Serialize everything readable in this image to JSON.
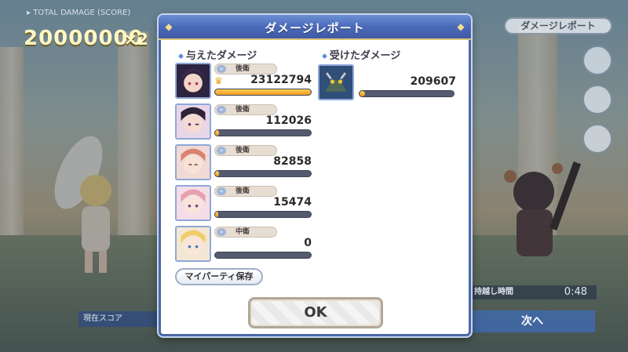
{
  "background": {
    "score_label": "▸ TOTAL DAMAGE (SCORE)",
    "score": "20000000",
    "multiplier": "×2",
    "report_button": "ダメージレポート",
    "timer_label": "持越し時間",
    "timer_value": "0:48",
    "bottom_label": "現在スコア",
    "next_button": "次へ"
  },
  "dialog": {
    "title": "ダメージレポート",
    "dealt_header": "与えたダメージ",
    "received_header": "受けたダメージ",
    "dealt": [
      {
        "position": "後衛",
        "damage": "23122794",
        "bar_fill": 1.0,
        "top": true
      },
      {
        "position": "後衛",
        "damage": "112026",
        "bar_fill": 0.04,
        "top": false
      },
      {
        "position": "後衛",
        "damage": "82858",
        "bar_fill": 0.04,
        "top": false
      },
      {
        "position": "後衛",
        "damage": "15474",
        "bar_fill": 0.03,
        "top": false
      },
      {
        "position": "中衛",
        "damage": "0",
        "bar_fill": 0.0,
        "top": false
      }
    ],
    "received": {
      "damage": "209607",
      "bar_fill": 0.06
    },
    "save_button": "マイパーティ保存",
    "ok_button": "OK"
  },
  "colors": {
    "header_blue": "#4a6ab9",
    "bar_orange": "#f29b1e",
    "bar_track": "#545b6e"
  },
  "icons": [
    "crown-icon",
    "position-icon",
    "diamond-bullet-icon"
  ]
}
